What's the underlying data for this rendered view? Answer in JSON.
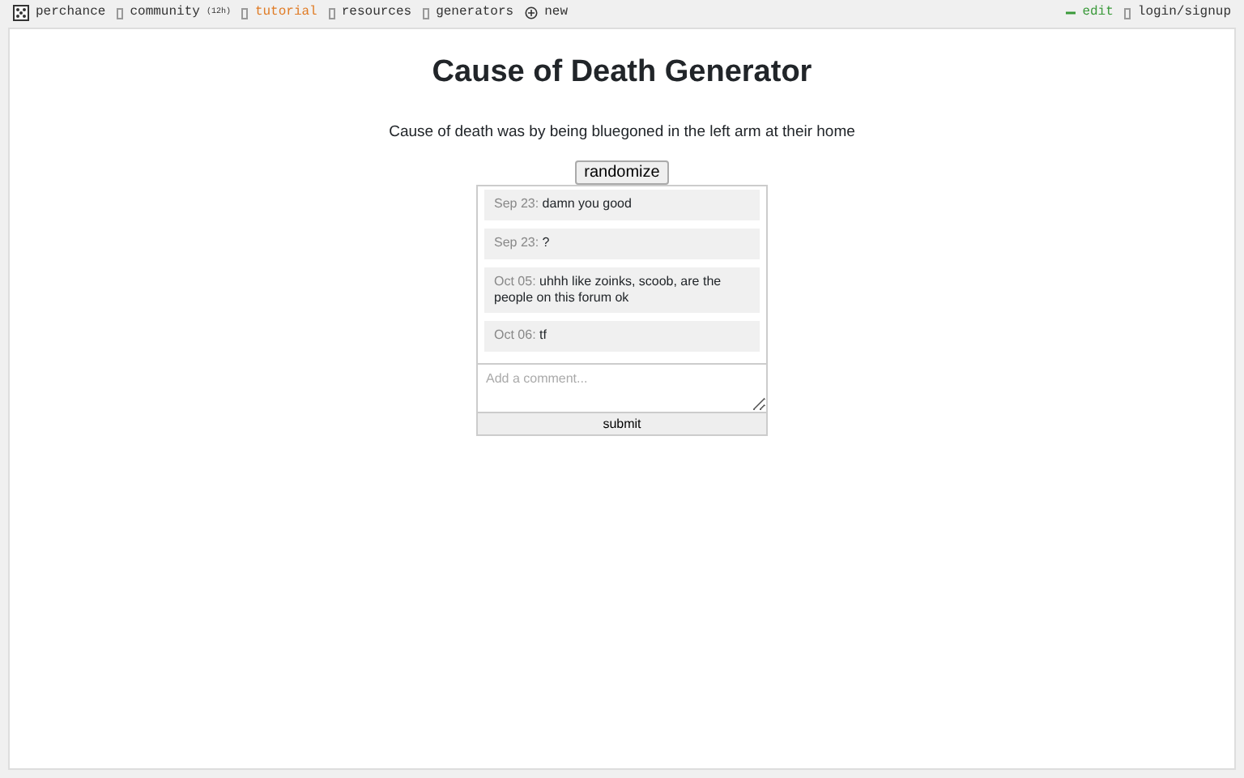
{
  "nav": {
    "logo": "perchance",
    "links": [
      {
        "kind": "icon",
        "label": "community",
        "count": "(12h)",
        "selected": false
      },
      {
        "kind": "icon",
        "label": "tutorial",
        "selected": true
      },
      {
        "kind": "icon",
        "label": "resources",
        "selected": false
      },
      {
        "kind": "icon",
        "label": "generators",
        "selected": false
      },
      {
        "kind": "plus",
        "label": "new",
        "selected": false
      }
    ],
    "right": [
      {
        "kind": "edit",
        "label": "edit"
      },
      {
        "kind": "icon",
        "label": "login/signup"
      }
    ]
  },
  "title": "Cause of Death Generator",
  "output": "Cause of death was by being bluegoned in the left arm at their home",
  "button": "randomize",
  "comments": [
    {
      "date": "Sep 23:",
      "text": "damn you good"
    },
    {
      "date": "Sep 23:",
      "text": "?"
    },
    {
      "date": "Oct 05:",
      "text": "uhhh like zoinks, scoob, are the people on this forum ok"
    },
    {
      "date": "Oct 06:",
      "text": "tf"
    }
  ],
  "comment_field": {
    "placeholder": "Add a comment..."
  },
  "submit": "submit"
}
